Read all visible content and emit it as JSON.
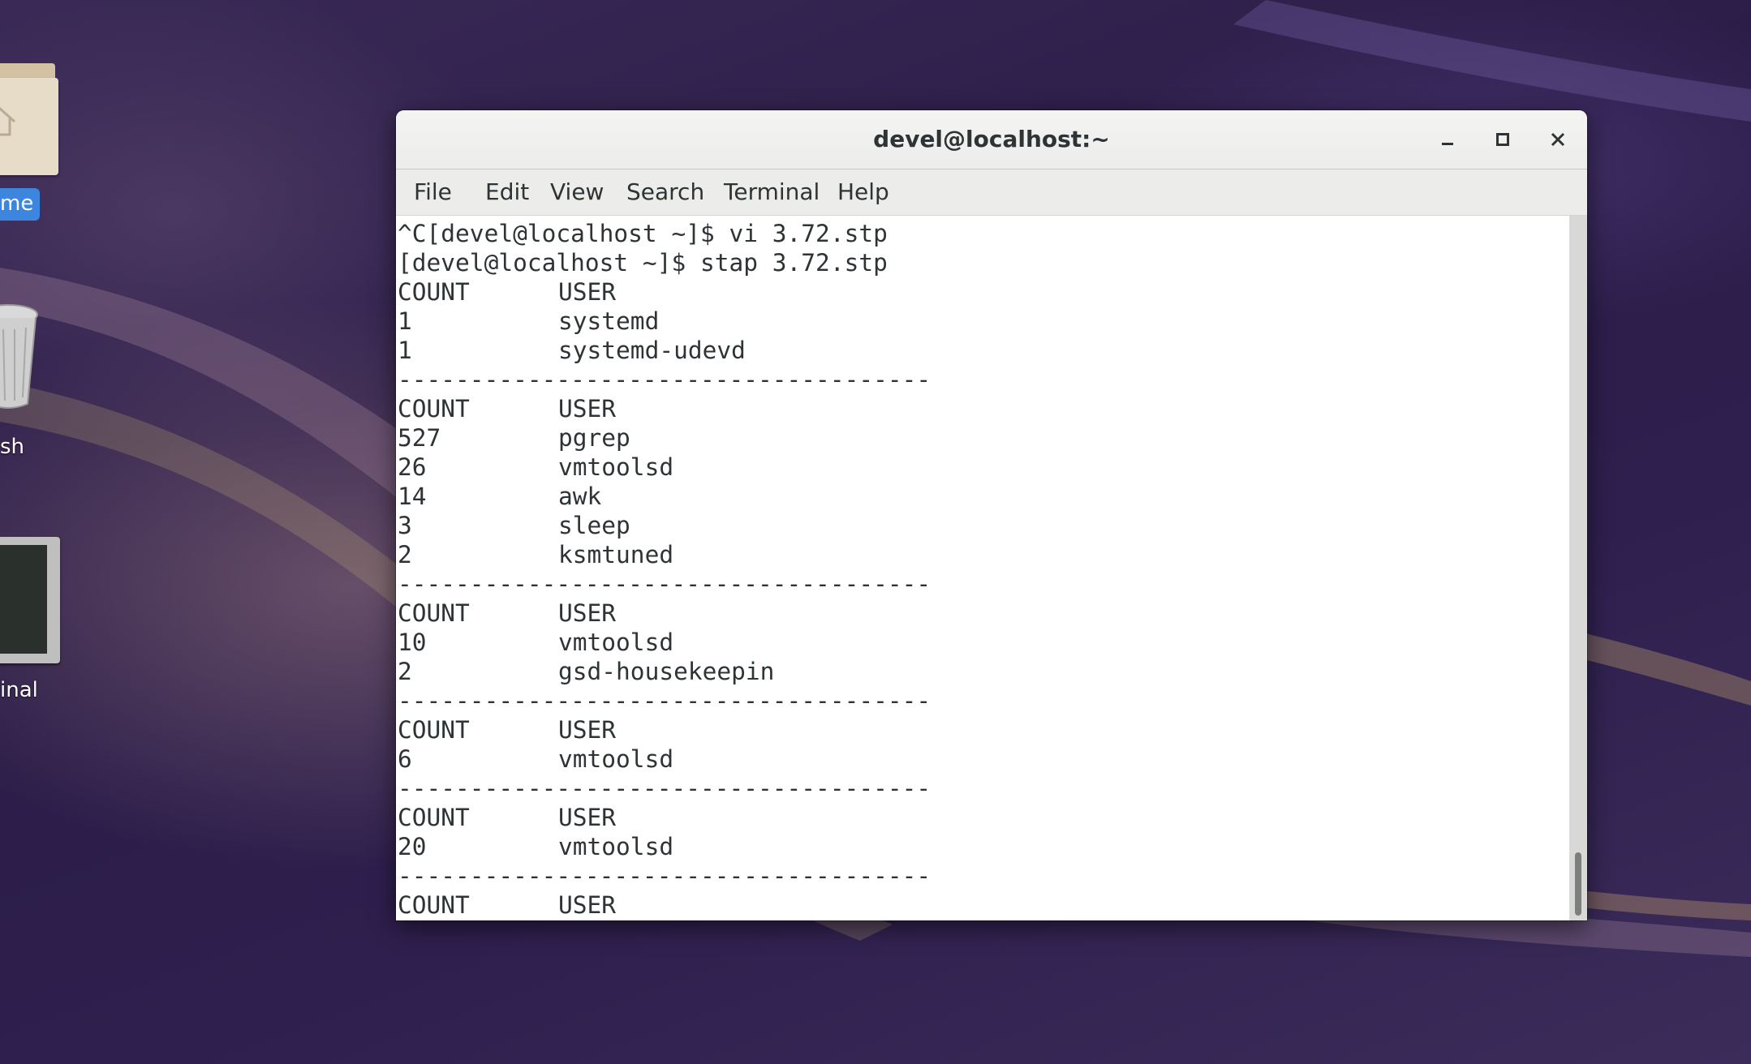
{
  "desktop": {
    "icons": [
      {
        "name": "home",
        "label": "me"
      },
      {
        "name": "trash",
        "label": "sh"
      },
      {
        "name": "terminal",
        "label": "inal"
      }
    ]
  },
  "window": {
    "title": "devel@localhost:~",
    "controls": {
      "minimize": "minimize-icon",
      "maximize": "maximize-icon",
      "close": "close-icon"
    }
  },
  "menubar": {
    "items": [
      {
        "label": "File"
      },
      {
        "label": "Edit"
      },
      {
        "label": "View"
      },
      {
        "label": "Search"
      },
      {
        "label": "Terminal"
      },
      {
        "label": "Help"
      }
    ]
  },
  "terminal": {
    "lines": [
      {
        "type": "text",
        "text": "^C[devel@localhost ~]$ vi 3.72.stp"
      },
      {
        "type": "text",
        "text": "[devel@localhost ~]$ stap 3.72.stp"
      },
      {
        "type": "row",
        "count": "COUNT",
        "user": "USER"
      },
      {
        "type": "row",
        "count": "1",
        "user": "systemd"
      },
      {
        "type": "row",
        "count": "1",
        "user": "systemd-udevd"
      },
      {
        "type": "text",
        "text": "-------------------------------------"
      },
      {
        "type": "row",
        "count": "COUNT",
        "user": "USER"
      },
      {
        "type": "row",
        "count": "527",
        "user": "pgrep"
      },
      {
        "type": "row",
        "count": "26",
        "user": "vmtoolsd"
      },
      {
        "type": "row",
        "count": "14",
        "user": "awk"
      },
      {
        "type": "row",
        "count": "3",
        "user": "sleep"
      },
      {
        "type": "row",
        "count": "2",
        "user": "ksmtuned"
      },
      {
        "type": "text",
        "text": "-------------------------------------"
      },
      {
        "type": "row",
        "count": "COUNT",
        "user": "USER"
      },
      {
        "type": "row",
        "count": "10",
        "user": "vmtoolsd"
      },
      {
        "type": "row",
        "count": "2",
        "user": "gsd-housekeepin"
      },
      {
        "type": "text",
        "text": "-------------------------------------"
      },
      {
        "type": "row",
        "count": "COUNT",
        "user": "USER"
      },
      {
        "type": "row",
        "count": "6",
        "user": "vmtoolsd"
      },
      {
        "type": "text",
        "text": "-------------------------------------"
      },
      {
        "type": "row",
        "count": "COUNT",
        "user": "USER"
      },
      {
        "type": "row",
        "count": "20",
        "user": "vmtoolsd"
      },
      {
        "type": "text",
        "text": "-------------------------------------"
      },
      {
        "type": "row",
        "count": "COUNT",
        "user": "USER"
      }
    ]
  }
}
